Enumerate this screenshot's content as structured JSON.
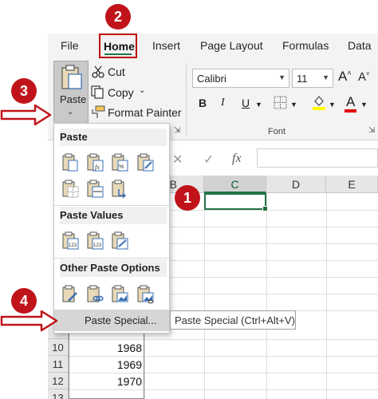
{
  "tabs": [
    "File",
    "Home",
    "Insert",
    "Page Layout",
    "Formulas",
    "Data"
  ],
  "clipboard": {
    "paste_label": "Paste",
    "cut_label": "Cut",
    "copy_label": "Copy",
    "format_painter_label": "Format Painter"
  },
  "font": {
    "family": "Calibri",
    "size": "11",
    "group_label": "Font",
    "bold": "B",
    "italic": "I",
    "underline": "U",
    "font_color": "A"
  },
  "formula_bar": {
    "fx": "fx"
  },
  "columns": [
    "B",
    "C",
    "D",
    "E"
  ],
  "rows": [
    {
      "num": "10",
      "value": "1968"
    },
    {
      "num": "11",
      "value": "1969"
    },
    {
      "num": "12",
      "value": "1970"
    },
    {
      "num": "13",
      "value": ""
    }
  ],
  "dropdown": {
    "paste_header": "Paste",
    "paste_values_header": "Paste Values",
    "other_header": "Other Paste Options",
    "paste_special": "Paste Special...",
    "tooltip": "Paste Special (Ctrl+Alt+V)"
  },
  "badges": [
    "1",
    "2",
    "3",
    "4"
  ],
  "colors": {
    "accent": "#217346",
    "annotation": "#c0141a"
  }
}
